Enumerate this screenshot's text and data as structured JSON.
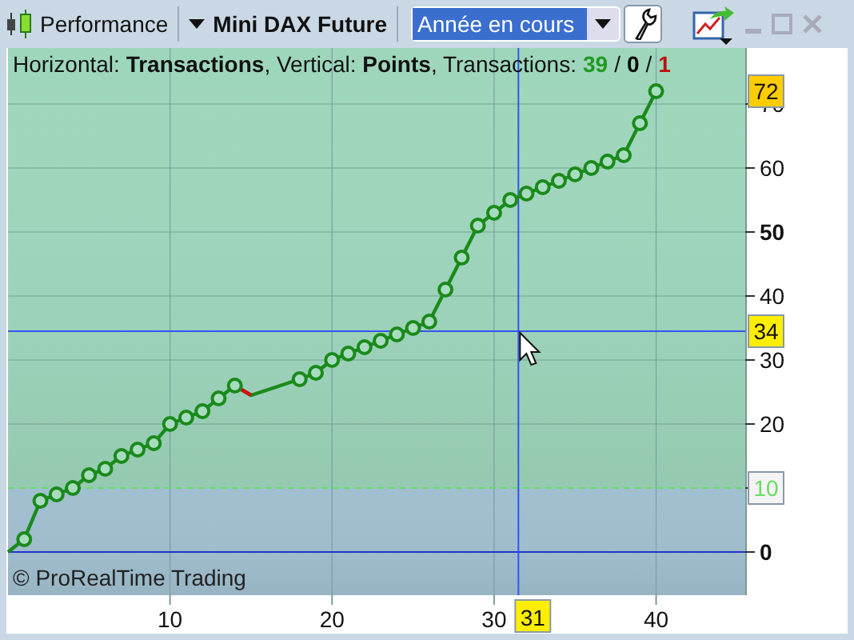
{
  "toolbar": {
    "title": "Performance",
    "instrument": "Mini DAX Future",
    "period": {
      "value": "Année en cours"
    }
  },
  "legend": {
    "text": "Horizontal: **Transactions**, Vertical: **Points**, Transactions:",
    "separator": "/",
    "counts": [
      {
        "value": "39",
        "color": "#229922"
      },
      {
        "value": "0",
        "color": "#000000"
      },
      {
        "value": "1",
        "color": "#bb1111"
      }
    ]
  },
  "chart_data": {
    "type": "line",
    "grid": true,
    "x": [
      0,
      1,
      2,
      3,
      4,
      5,
      6,
      7,
      8,
      9,
      10,
      11,
      12,
      13,
      14,
      15,
      18,
      19,
      20,
      21,
      22,
      23,
      24,
      25,
      26,
      27,
      28,
      29,
      30,
      31,
      32,
      33,
      34,
      35,
      36,
      37,
      38,
      39,
      40
    ],
    "series": [
      {
        "color": "#1a8a1a",
        "marker": "o",
        "values": [
          0,
          2,
          8,
          9,
          10,
          12,
          13,
          15,
          16,
          17,
          20,
          21,
          22,
          24,
          26,
          24.5,
          27,
          28,
          30,
          31,
          32,
          33,
          34,
          35,
          36,
          41,
          46,
          51,
          53,
          55,
          56,
          57,
          58,
          59,
          60,
          61,
          62,
          67,
          72
        ]
      }
    ],
    "xlim": [
      0,
      45.5
    ],
    "ylim": [
      -6.75,
      78.75
    ],
    "xticks": [
      10,
      20,
      30,
      40
    ],
    "yticks": [
      0,
      10,
      20,
      30,
      40,
      50,
      60,
      70
    ],
    "bands": [
      {
        "axis": "y",
        "from": 10,
        "to": 78.75,
        "color": "#9ed6bc"
      },
      {
        "axis": "y",
        "from": -6.75,
        "to": 10,
        "color": "#a0bfcf"
      }
    ],
    "ref_lines": [
      {
        "axis": "y",
        "value": 10,
        "label": "10",
        "color": "#66dd66"
      },
      {
        "axis": "y",
        "value": 34.5,
        "label": "34",
        "color": "#3355ee"
      },
      {
        "axis": "x",
        "value": 31.5,
        "label": "31",
        "color": "#3355ee"
      }
    ],
    "annotations": [
      "72"
    ]
  },
  "copyright": "© ProRealTime Trading"
}
